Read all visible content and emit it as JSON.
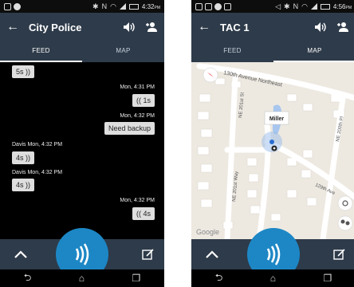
{
  "left": {
    "status": {
      "time": "4:32",
      "ampm": "PM"
    },
    "title": "City Police",
    "tabs": [
      {
        "label": "FEED",
        "active": true
      },
      {
        "label": "MAP",
        "active": false
      }
    ],
    "messages": [
      {
        "sender": "",
        "time": "",
        "duration": "5s",
        "side": "left"
      },
      {
        "sender": "",
        "time": "Mon, 4:31 PM",
        "duration": "1s",
        "side": "right"
      },
      {
        "sender": "",
        "time": "Mon, 4:32 PM",
        "text": "Need backup",
        "side": "right"
      },
      {
        "sender": "Davis",
        "time": "Mon, 4:32 PM",
        "duration": "4s",
        "side": "left"
      },
      {
        "sender": "Davis",
        "time": "Mon, 4:32 PM",
        "duration": "4s",
        "side": "left"
      },
      {
        "sender": "",
        "time": "Mon, 4:32 PM",
        "duration": "4s",
        "side": "right"
      }
    ]
  },
  "right": {
    "status": {
      "time": "4:56",
      "ampm": "PM"
    },
    "title": "TAC 1",
    "tabs": [
      {
        "label": "FEED",
        "active": false
      },
      {
        "label": "MAP",
        "active": true
      }
    ],
    "map": {
      "streets": [
        "130th Avenue Northeast",
        "NE 201st St",
        "NE 201st Way",
        "129th Ave",
        "NE 200th Pl"
      ],
      "marker_label": "Miller",
      "attribution": "Google"
    }
  },
  "colors": {
    "toolbar": "#2e3b4a",
    "ptt": "#1d87c5",
    "bubble": "#dedede"
  }
}
